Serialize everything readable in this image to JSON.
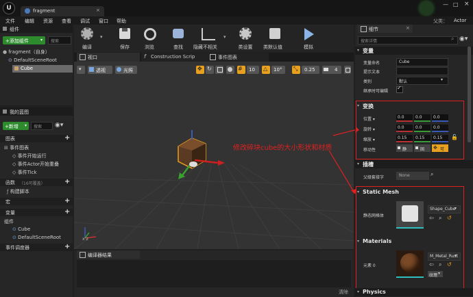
{
  "titlebar": {
    "tab_title": "fragment",
    "parent_class_label": "父类：",
    "parent_class_value": "Actor"
  },
  "menu": [
    "文件",
    "编辑",
    "资源",
    "查看",
    "调试",
    "窗口",
    "帮助"
  ],
  "toolbar": {
    "items": [
      "编译",
      "保存",
      "浏览",
      "查找",
      "隐藏不相关",
      "类设置",
      "类默认值",
      "模拟"
    ]
  },
  "components": {
    "title": "组件",
    "add_button": "+添加组件",
    "search_placeholder": "搜索",
    "root": "fragment（自身）",
    "scene_root": "DefaultSceneRoot",
    "cube": "Cube"
  },
  "blueprint": {
    "title": "我的蓝图",
    "new_button": "+新增",
    "search_placeholder": "搜索",
    "graphs_header": "图表",
    "event_graph": "事件图表",
    "event_items": [
      "事件开始运行",
      "事件Actor开始重叠",
      "事件Tick"
    ],
    "functions_header": "函数",
    "functions_overridable": "（16可覆盖）",
    "construction_script": "构建脚本",
    "macros_header": "宏",
    "variables_header": "变量",
    "components_group": "组件",
    "var_cube": "Cube",
    "var_root": "DefaultSceneRoot",
    "dispatchers_header": "事件调度器"
  },
  "center_tabs": [
    "视口",
    "Construction Scrip",
    "事件图表"
  ],
  "viewport": {
    "perspective_btn": "透视",
    "lit_btn": "光照",
    "grid_snap": "10",
    "rot_snap": "10°",
    "scale_snap": "0.25",
    "camera_speed": "4",
    "annotation": "修改碎块cube的大小形状和材质"
  },
  "compiler": {
    "title": "编译器结果",
    "clear": "清除"
  },
  "details": {
    "title": "细节",
    "search_placeholder": "搜索详情",
    "variables_section": "变量",
    "var_name_label": "变量命名",
    "var_name_value": "Cube",
    "tooltip_label": "提示文本",
    "category_label": "类别",
    "category_value": "默认",
    "editable_label": "继承时可编辑",
    "transform_section": "变换",
    "location_label": "位置",
    "rotation_label": "旋转",
    "scale_label": "缩放",
    "mobility_label": "移动性",
    "location": [
      "0.0",
      "0.0",
      "0.0"
    ],
    "rotation": [
      "0.0",
      "0.0",
      "0.0"
    ],
    "scale": [
      "0.15",
      "0.15",
      "0.15"
    ],
    "mobility_options": [
      "静",
      "固",
      "可"
    ],
    "sockets_section": "插槽",
    "parent_socket_label": "父级套接字",
    "parent_socket_value": "None",
    "static_mesh_section": "Static Mesh",
    "static_mesh_label": "静态网格体",
    "static_mesh_value": "Shape_Cube",
    "materials_section": "Materials",
    "element_label": "元素 0",
    "material_value": "M_Metal_Rust",
    "material_texture_btn": "纹理",
    "physics_section": "Physics"
  },
  "colors": {
    "highlight_red": "#e02020",
    "accent_green": "#2f8a2f",
    "accent_orange": "#e8a020",
    "transform_x": "#b83030",
    "transform_y": "#3a9a3a",
    "transform_z": "#3a5ab8"
  }
}
